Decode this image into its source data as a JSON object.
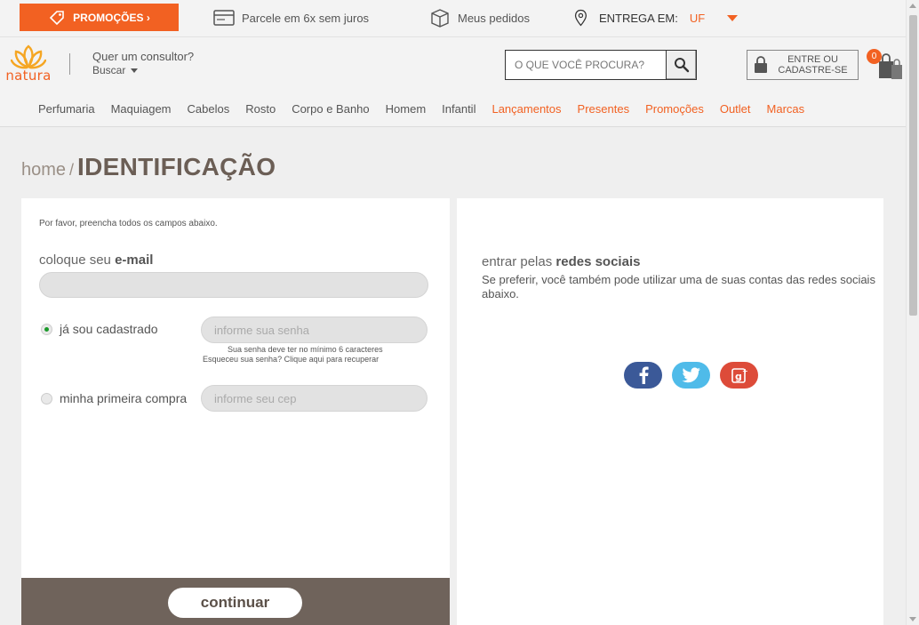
{
  "colors": {
    "brand": "#f26122",
    "dark_brown": "#6f635b",
    "facebook": "#3b5998",
    "twitter": "#4fbbe9",
    "google": "#dd4b39"
  },
  "topbar": {
    "promo_label": "PROMOÇÕES ›",
    "parcele": "Parcele em 6x sem juros",
    "pedidos": "Meus pedidos",
    "entrega_label": "ENTREGA EM:",
    "entrega_uf": "UF"
  },
  "header": {
    "logo_text": "natura",
    "consultor_title": "Quer um consultor?",
    "consultor_buscar": "Buscar",
    "search_placeholder": "O QUE VOCÊ PROCURA?",
    "login_line1": "ENTRE OU",
    "login_line2": "CADASTRE-SE",
    "cart_count": "0"
  },
  "nav": [
    {
      "label": "Perfumaria",
      "highlight": false
    },
    {
      "label": "Maquiagem",
      "highlight": false
    },
    {
      "label": "Cabelos",
      "highlight": false
    },
    {
      "label": "Rosto",
      "highlight": false
    },
    {
      "label": "Corpo e Banho",
      "highlight": false
    },
    {
      "label": "Homem",
      "highlight": false
    },
    {
      "label": "Infantil",
      "highlight": false
    },
    {
      "label": "Lançamentos",
      "highlight": true
    },
    {
      "label": "Presentes",
      "highlight": true
    },
    {
      "label": "Promoções",
      "highlight": true
    },
    {
      "label": "Outlet",
      "highlight": true
    },
    {
      "label": "Marcas",
      "highlight": true
    }
  ],
  "breadcrumb": {
    "home": "home",
    "separator": "/",
    "page": "IDENTIFICAÇÃO"
  },
  "form": {
    "instruction": "Por favor, preencha todos os campos abaixo.",
    "email_label_pre": "coloque seu ",
    "email_label_bold": "e-mail",
    "email_value": "",
    "radio_registered_label": "já sou cadastrado",
    "radio_registered_checked": true,
    "password_placeholder": "informe sua senha",
    "password_hint": "Sua senha deve ter no mínimo 6 caracteres",
    "forgot_hint": "Esqueceu sua senha? Clique aqui para recuperar",
    "radio_first_label": "minha primeira compra",
    "radio_first_checked": false,
    "cep_placeholder": "informe seu cep",
    "continue_label": "continuar"
  },
  "social": {
    "title_pre": "entrar pelas ",
    "title_bold": "redes sociais",
    "description": "Se preferir, você também pode utilizar uma de suas contas das redes sociais abaixo.",
    "icons": [
      "facebook-icon",
      "twitter-icon",
      "google-plus-icon"
    ]
  }
}
